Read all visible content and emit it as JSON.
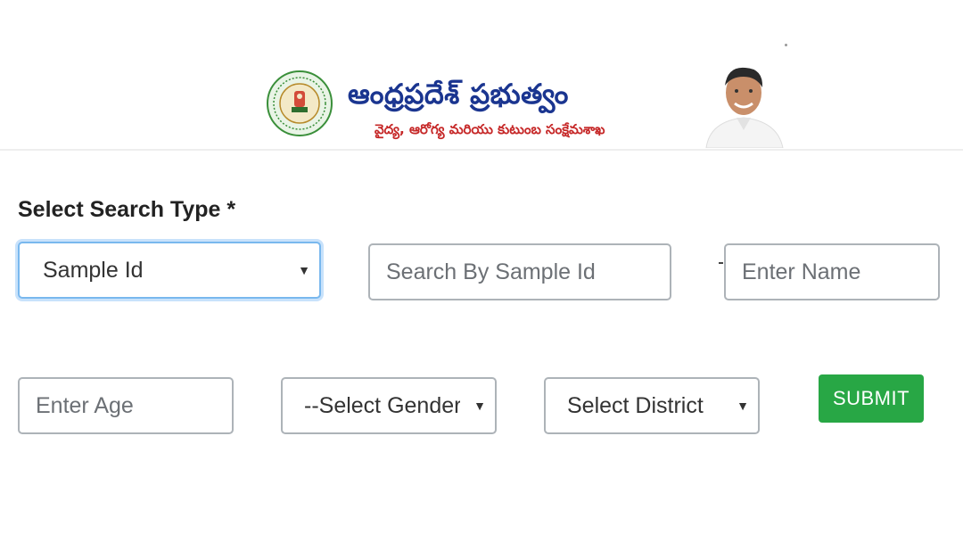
{
  "header": {
    "gov_title": "ఆంధ్రప్రదేశ్ ప్రభుత్వం",
    "dept_title": "వైద్య, ఆరోగ్య మరియు కుటుంబ సంక్షేమశాఖ",
    "emblem_icon": "andhra-pradesh-emblem-icon",
    "portrait_icon": "chief-minister-portrait",
    "title_color": "#1a3590",
    "subtitle_color": "#c62828"
  },
  "form": {
    "search_type_label": "Select Search Type *",
    "search_type_value": "Sample Id",
    "search_placeholder": "Search By Sample Id",
    "name_placeholder": "Enter Name",
    "age_placeholder": "Enter Age",
    "gender_value": "--Select Gender",
    "district_value": "Select District",
    "submit_label": "SUBMIT",
    "submit_color": "#28a745"
  }
}
